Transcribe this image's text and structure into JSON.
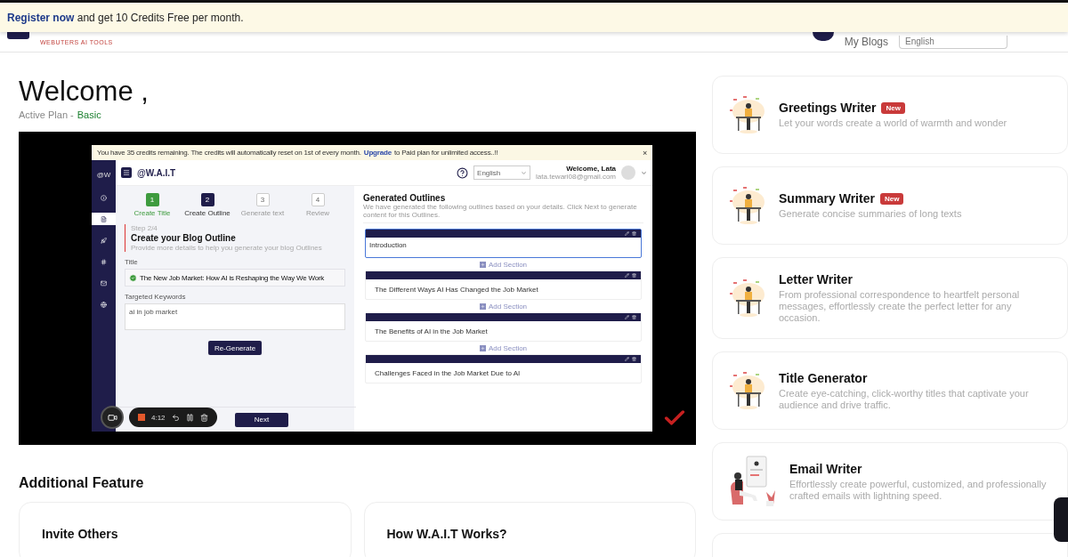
{
  "banner": {
    "link": "Register now",
    "text": "and get 10 Credits Free per month."
  },
  "header": {
    "logo_text": "WEBUTERS AI TOOLS",
    "nav": "My Blogs",
    "language": "English"
  },
  "welcome": {
    "title": "Welcome ,",
    "plan_label": "Active Plan -",
    "plan": "Basic"
  },
  "video": {
    "notice": {
      "text": "You have 35 credits remaining. The credits will automatically reset on 1st of every month.",
      "link": "Upgrade",
      "after": "to Paid plan for unlimited access..!!",
      "close": "×"
    },
    "nav_logo": "@W",
    "logo": "@W.A.I.T",
    "language": "English",
    "user": {
      "greeting": "Welcome, Lata",
      "email": "lata.tewari08@gmail.com"
    },
    "steps": [
      {
        "number": "1",
        "label": "Create Title",
        "completed": true,
        "selected": false
      },
      {
        "number": "2",
        "label": "Create Outline",
        "completed": false,
        "selected": true
      },
      {
        "number": "3",
        "label": "Generate text",
        "completed": false,
        "selected": false
      },
      {
        "number": "4",
        "label": "Review",
        "completed": false,
        "selected": false
      }
    ],
    "step_label": "Step 2/4",
    "heading": "Create your Blog Outline",
    "subheading": "Provide more details to help you generate your blog Outlines",
    "title_label": "Title",
    "title_value": "The New Job Market: How AI is Reshaping the Way We Work",
    "keywords_label": "Targeted Keywords",
    "keywords_value": "ai in job market",
    "regenerate": "Re-Generate",
    "next": "Next",
    "outlines_heading": "Generated Outlines",
    "outlines_text": "We have generated the following outlines based on your details. Click Next to generate content for this Outlines.",
    "outlines": [
      {
        "text": "Introduction",
        "focused": true
      },
      {
        "text": "The Different Ways AI Has Changed the Job Market",
        "focused": false
      },
      {
        "text": "The Benefits of AI in the Job Market",
        "focused": false
      },
      {
        "text": "Challenges Faced in the Job Market Due to AI",
        "focused": false
      }
    ],
    "add_section": [
      "Add Section",
      "Add Section",
      "Add Section"
    ],
    "recorder": {
      "time": "4:12"
    }
  },
  "additional": {
    "heading": "Additional Feature",
    "cards": [
      {
        "title": "Invite Others"
      },
      {
        "title": "How W.A.I.T Works?"
      }
    ]
  },
  "tools": [
    {
      "kind": "desk",
      "title": "Greetings Writer",
      "badge": "New",
      "description": "Let your words create a world of warmth and wonder"
    },
    {
      "kind": "desk",
      "title": "Summary Writer",
      "badge": "New",
      "description": "Generate concise summaries of long texts"
    },
    {
      "kind": "desk",
      "title": "Letter Writer",
      "description": "From professional correspondence to heartfelt personal messages, effortlessly create the perfect letter for any occasion."
    },
    {
      "kind": "desk",
      "title": "Title Generator",
      "description": "Create eye-catching, click-worthy titles that captivate your audience and drive traffic."
    },
    {
      "kind": "email",
      "title": "Email Writer",
      "description": "Effortlessly create powerful, customized, and professionally crafted emails with lightning speed."
    }
  ]
}
